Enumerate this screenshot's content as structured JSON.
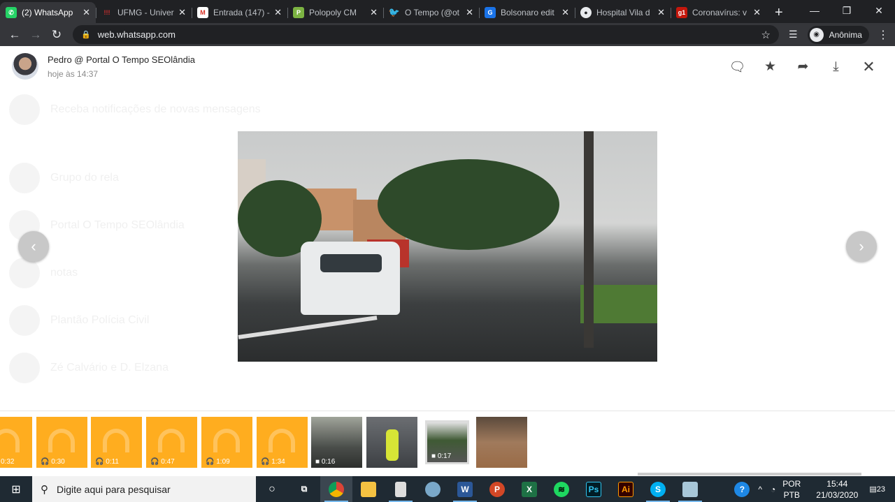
{
  "browser": {
    "tabs": [
      {
        "label": "(2) WhatsApp",
        "color": "#25d366",
        "glyph": "W",
        "active": true
      },
      {
        "label": "UFMG - Univer",
        "color": "#b3261e",
        "glyph": "!!!"
      },
      {
        "label": "Entrada (147) -",
        "color": "#d93025",
        "glyph": "M"
      },
      {
        "label": "Polopoly CM",
        "color": "#6aa84f",
        "glyph": "P"
      },
      {
        "label": "O Tempo (@ot",
        "color": "#1da1f2",
        "glyph": "t"
      },
      {
        "label": "Bolsonaro edit",
        "color": "#1a73e8",
        "glyph": "G"
      },
      {
        "label": "Hospital Vila d",
        "color": "#e8eaed",
        "glyph": "●"
      },
      {
        "label": "Coronavírus: v",
        "color": "#c4170c",
        "glyph": "g1"
      }
    ],
    "new_tab": "+",
    "url": "web.whatsapp.com",
    "profile": "Anônima"
  },
  "background_chats": [
    {
      "name": "Receba notificações de novas mensagens"
    },
    {
      "name": "Grupo do rela"
    },
    {
      "name": "Portal O Tempo SEOlândia"
    },
    {
      "name": "notas"
    },
    {
      "name": "Plantão Polícia Civil"
    },
    {
      "name": "Zé Calvário e D. Elzana"
    }
  ],
  "viewer": {
    "sender": "Pedro @ Portal O Tempo SEOlândia",
    "time": "hoje às 14:37",
    "actions": [
      "comment-icon",
      "star-icon",
      "forward-icon",
      "download-icon",
      "close-icon"
    ]
  },
  "media_strip": [
    {
      "type": "audio",
      "duration": "0:32"
    },
    {
      "type": "audio",
      "duration": "0:30"
    },
    {
      "type": "audio",
      "duration": "0:11"
    },
    {
      "type": "audio",
      "duration": "0:47"
    },
    {
      "type": "audio",
      "duration": "1:09"
    },
    {
      "type": "audio",
      "duration": "1:34"
    },
    {
      "type": "video",
      "duration": "0:16"
    },
    {
      "type": "image",
      "duration": ""
    },
    {
      "type": "video",
      "duration": "0:17",
      "selected": true
    },
    {
      "type": "image",
      "duration": ""
    }
  ],
  "taskbar": {
    "search_placeholder": "Digite aqui para pesquisar",
    "lang1": "POR",
    "lang2": "PTB",
    "time": "15:44",
    "date": "21/03/2020",
    "notifications": "23"
  }
}
